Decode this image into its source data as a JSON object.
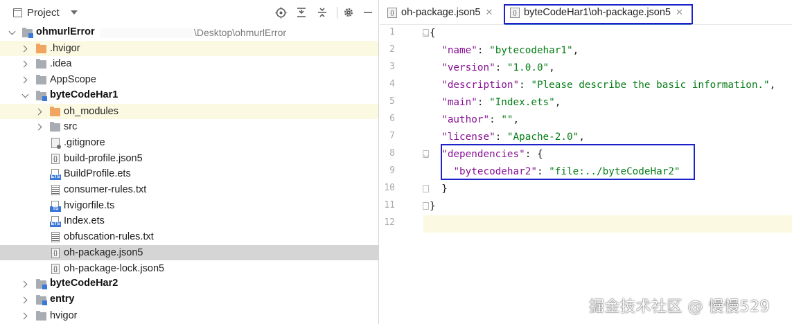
{
  "project_panel": {
    "title": "Project",
    "root_name": "ohmurlError",
    "root_path": "\\Desktop\\ohmurlError",
    "items": [
      {
        "label": ".hvigor",
        "kind": "folder-orange",
        "expanded": false
      },
      {
        "label": ".idea",
        "kind": "folder",
        "expanded": false
      },
      {
        "label": "AppScope",
        "kind": "folder",
        "expanded": false
      },
      {
        "label": "byteCodeHar1",
        "kind": "module",
        "expanded": true
      },
      {
        "label": "oh_modules",
        "kind": "folder-orange",
        "expanded": false
      },
      {
        "label": "src",
        "kind": "folder",
        "expanded": false
      },
      {
        "label": ".gitignore",
        "kind": "git-file"
      },
      {
        "label": "build-profile.json5",
        "kind": "json-file"
      },
      {
        "label": "BuildProfile.ets",
        "kind": "ets-file",
        "badge": "ETS"
      },
      {
        "label": "consumer-rules.txt",
        "kind": "text-file"
      },
      {
        "label": "hvigorfile.ts",
        "kind": "ts-file",
        "badge": "TS"
      },
      {
        "label": "Index.ets",
        "kind": "ets-file",
        "badge": "ETS"
      },
      {
        "label": "obfuscation-rules.txt",
        "kind": "text-file"
      },
      {
        "label": "oh-package.json5",
        "kind": "json-file",
        "selected": true
      },
      {
        "label": "oh-package-lock.json5",
        "kind": "json-file"
      },
      {
        "label": "byteCodeHar2",
        "kind": "module",
        "expanded": false
      },
      {
        "label": "entry",
        "kind": "module",
        "expanded": false
      },
      {
        "label": "hvigor",
        "kind": "folder",
        "expanded": false
      }
    ]
  },
  "editor": {
    "tabs": [
      {
        "label": "oh-package.json5",
        "active": false
      },
      {
        "label": "byteCodeHar1\\oh-package.json5",
        "active": true
      }
    ],
    "line_numbers": [
      "1",
      "2",
      "3",
      "4",
      "5",
      "6",
      "7",
      "8",
      "9",
      "10",
      "11",
      "12"
    ],
    "lines": [
      {
        "parts": [
          {
            "t": "{",
            "c": "p"
          }
        ]
      },
      {
        "parts": [
          {
            "t": "  ",
            "c": "p"
          },
          {
            "t": "\"name\"",
            "c": "k"
          },
          {
            "t": ": ",
            "c": "p"
          },
          {
            "t": "\"bytecodehar1\"",
            "c": "s"
          },
          {
            "t": ",",
            "c": "p"
          }
        ]
      },
      {
        "parts": [
          {
            "t": "  ",
            "c": "p"
          },
          {
            "t": "\"version\"",
            "c": "k"
          },
          {
            "t": ": ",
            "c": "p"
          },
          {
            "t": "\"1.0.0\"",
            "c": "s"
          },
          {
            "t": ",",
            "c": "p"
          }
        ]
      },
      {
        "parts": [
          {
            "t": "  ",
            "c": "p"
          },
          {
            "t": "\"description\"",
            "c": "k"
          },
          {
            "t": ": ",
            "c": "p"
          },
          {
            "t": "\"Please describe the basic information.\"",
            "c": "s"
          },
          {
            "t": ",",
            "c": "p"
          }
        ]
      },
      {
        "parts": [
          {
            "t": "  ",
            "c": "p"
          },
          {
            "t": "\"main\"",
            "c": "k"
          },
          {
            "t": ": ",
            "c": "p"
          },
          {
            "t": "\"Index.ets\"",
            "c": "s"
          },
          {
            "t": ",",
            "c": "p"
          }
        ]
      },
      {
        "parts": [
          {
            "t": "  ",
            "c": "p"
          },
          {
            "t": "\"author\"",
            "c": "k"
          },
          {
            "t": ": ",
            "c": "p"
          },
          {
            "t": "\"\"",
            "c": "s"
          },
          {
            "t": ",",
            "c": "p"
          }
        ]
      },
      {
        "parts": [
          {
            "t": "  ",
            "c": "p"
          },
          {
            "t": "\"license\"",
            "c": "k"
          },
          {
            "t": ": ",
            "c": "p"
          },
          {
            "t": "\"Apache-2.0\"",
            "c": "s"
          },
          {
            "t": ",",
            "c": "p"
          }
        ]
      },
      {
        "parts": [
          {
            "t": "  ",
            "c": "p"
          },
          {
            "t": "\"dependencies\"",
            "c": "k"
          },
          {
            "t": ": {",
            "c": "p"
          }
        ]
      },
      {
        "parts": [
          {
            "t": "    ",
            "c": "p"
          },
          {
            "t": "\"bytecodehar2\"",
            "c": "k"
          },
          {
            "t": ": ",
            "c": "p"
          },
          {
            "t": "\"file:../byteCodeHar2\"",
            "c": "s"
          }
        ]
      },
      {
        "parts": [
          {
            "t": "  }",
            "c": "p"
          }
        ]
      },
      {
        "parts": [
          {
            "t": "}",
            "c": "p"
          }
        ]
      },
      {
        "parts": [
          {
            "t": "",
            "c": "p"
          }
        ]
      }
    ],
    "current_line": 12
  },
  "colors": {
    "json_key": "#871094",
    "json_string": "#067d17",
    "highlight_box": "#1c22c8",
    "current_line_bg": "#fcf9e2",
    "selected_row_bg": "#d5d5d5"
  },
  "watermark": "掘金技术社区 @ 慢慢529"
}
